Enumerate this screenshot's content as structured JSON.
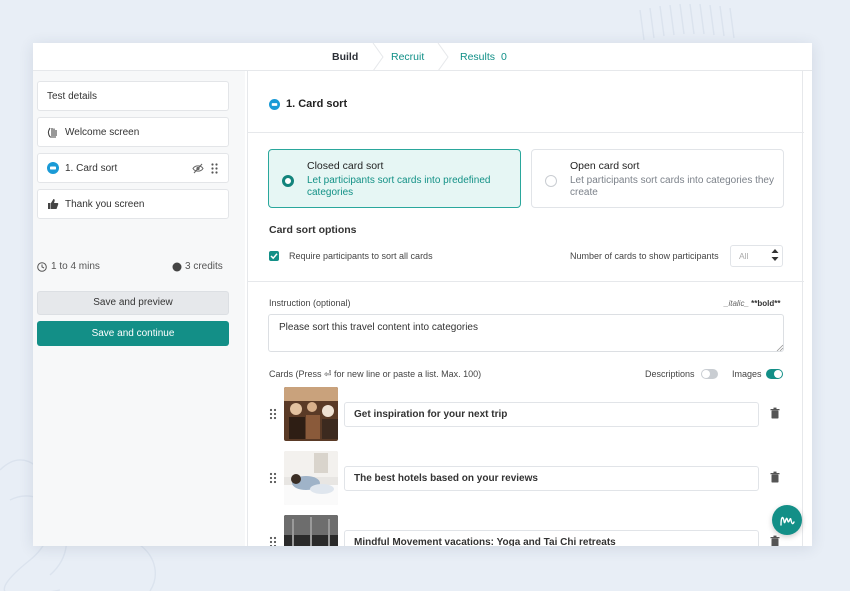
{
  "nav": {
    "tabs": [
      {
        "label": "Build"
      },
      {
        "label": "Recruit"
      },
      {
        "label": "Results",
        "count": "0"
      }
    ]
  },
  "sidebar": {
    "items": [
      {
        "label": "Test details"
      },
      {
        "label": "Welcome screen",
        "icon": "waving-hand-icon"
      },
      {
        "label": "1. Card sort",
        "icon": "card-sort-icon"
      },
      {
        "label": "Thank you screen",
        "icon": "thumbs-up-icon"
      }
    ],
    "duration": "1 to 4 mins",
    "credits": "3 credits",
    "save_preview": "Save and preview",
    "save_continue": "Save and continue"
  },
  "main": {
    "section_title": "1. Card sort",
    "options": [
      {
        "title": "Closed card sort",
        "desc": "Let participants sort cards into predefined categories",
        "selected": true
      },
      {
        "title": "Open card sort",
        "desc": "Let participants sort cards into categories they create",
        "selected": false
      }
    ],
    "card_sort_options_title": "Card sort options",
    "require_all_label": "Require participants to sort all cards",
    "require_all_checked": true,
    "num_cards_label": "Number of cards to show participants",
    "num_cards_value": "All",
    "instruction_label": "Instruction (optional)",
    "format_hint_italic": "_italic_",
    "format_hint_bold": "**bold**",
    "instruction_value": "Please sort this travel content into categories",
    "cards_label": "Cards (Press ⏎ for new line or paste a list. Max. 100)",
    "descriptions_label": "Descriptions",
    "descriptions_on": false,
    "images_label": "Images",
    "images_on": true,
    "cards": [
      {
        "text": "Get inspiration for your next trip"
      },
      {
        "text": "The best hotels based on your reviews"
      },
      {
        "text": "Mindful Movement vacations: Yoga and Tai Chi retreats"
      }
    ]
  },
  "colors": {
    "accent": "#138f87",
    "accent_light": "#e6f6f4",
    "background": "#e8eef6"
  }
}
